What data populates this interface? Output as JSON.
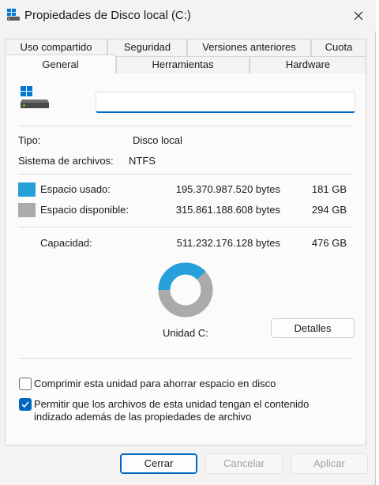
{
  "window": {
    "title": "Propiedades de Disco local (C:)"
  },
  "tabs_row1": [
    {
      "label": "Uso compartido"
    },
    {
      "label": "Seguridad"
    },
    {
      "label": "Versiones anteriores"
    },
    {
      "label": "Cuota"
    }
  ],
  "tabs_row2": [
    {
      "label": "General",
      "active": true
    },
    {
      "label": "Herramientas"
    },
    {
      "label": "Hardware"
    }
  ],
  "general": {
    "name_value": "",
    "type_label": "Tipo:",
    "type_value": "Disco local",
    "fs_label": "Sistema de archivos:",
    "fs_value": "NTFS",
    "used": {
      "label": "Espacio usado:",
      "bytes": "195.370.987.520 bytes",
      "size": "181 GB",
      "color": "#26a0da"
    },
    "free": {
      "label": "Espacio disponible:",
      "bytes": "315.861.188.608 bytes",
      "size": "294 GB",
      "color": "#aaaaaa"
    },
    "capacity": {
      "label": "Capacidad:",
      "bytes": "511.232.176.128 bytes",
      "size": "476 GB"
    },
    "used_fraction": 0.382,
    "drive_label": "Unidad C:",
    "details_button": "Detalles",
    "compress_label": "Comprimir esta unidad para ahorrar espacio en disco",
    "compress_checked": false,
    "index_label_line1": "Permitir que los archivos de esta unidad tengan el contenido",
    "index_label_line2": "indizado además de las propiedades de archivo",
    "index_checked": true
  },
  "buttons": {
    "close": "Cerrar",
    "cancel": "Cancelar",
    "apply": "Aplicar"
  },
  "colors": {
    "accent": "#0067c0",
    "used": "#26a0da",
    "free": "#aaaaaa"
  }
}
